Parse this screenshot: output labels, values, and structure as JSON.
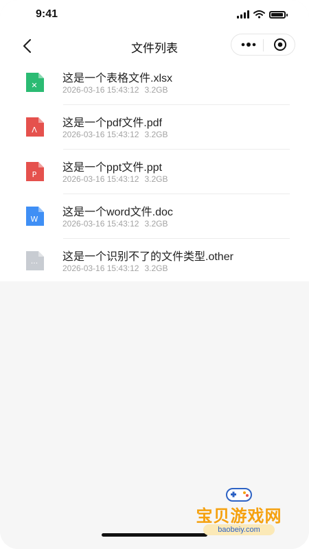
{
  "status": {
    "time": "9:41"
  },
  "nav": {
    "title": "文件列表"
  },
  "files": [
    {
      "name": "这是一个表格文件.xlsx",
      "date": "2026-03-16 15:43:12",
      "size": "3.2GB",
      "color": "#2bbb73",
      "glyph": "✕",
      "icon": "xlsx-file-icon"
    },
    {
      "name": "这是一个pdf文件.pdf",
      "date": "2026-03-16 15:43:12",
      "size": "3.2GB",
      "color": "#e5514d",
      "glyph": "Λ",
      "icon": "pdf-file-icon"
    },
    {
      "name": "这是一个ppt文件.ppt",
      "date": "2026-03-16 15:43:12",
      "size": "3.2GB",
      "color": "#e5514d",
      "glyph": "P",
      "icon": "ppt-file-icon"
    },
    {
      "name": "这是一个word文件.doc",
      "date": "2026-03-16 15:43:12",
      "size": "3.2GB",
      "color": "#3f8ff5",
      "glyph": "W",
      "icon": "word-file-icon"
    },
    {
      "name": "这是一个识别不了的文件类型.other",
      "date": "2026-03-16 15:43:12",
      "size": "3.2GB",
      "color": "#c8ccd2",
      "glyph": "···",
      "icon": "unknown-file-icon"
    }
  ],
  "watermark": {
    "text": "宝贝游戏网",
    "url": "baobeiy.com"
  }
}
